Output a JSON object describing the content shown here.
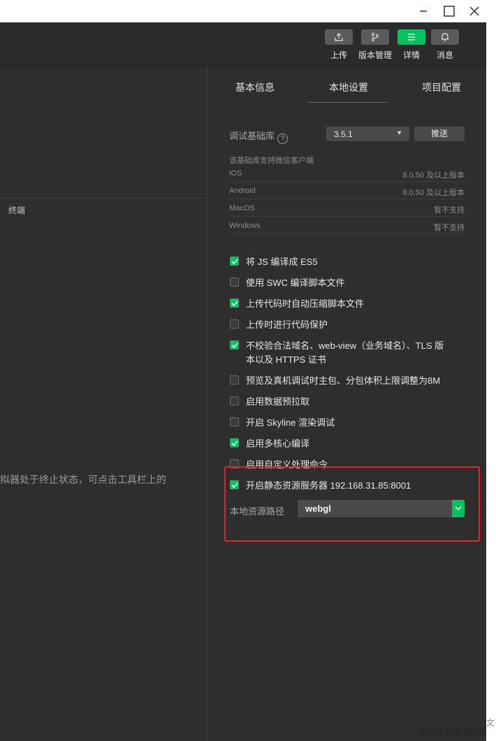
{
  "window_controls": {
    "minimize_icon": "minimize-icon",
    "maximize_icon": "maximize-icon",
    "close_icon": "close-icon"
  },
  "toolbar": {
    "buttons": [
      {
        "label": "上传",
        "icon": "upload-icon"
      },
      {
        "label": "版本管理",
        "icon": "branch-icon"
      },
      {
        "label": "详情",
        "icon": "menu-icon",
        "active": true
      },
      {
        "label": "消息",
        "icon": "bell-icon"
      }
    ]
  },
  "left_pane": {
    "terminal_tab": "终端",
    "simulator_message": "拟器处于终止状态，可点击工具栏上的"
  },
  "tabs": [
    "基本信息",
    "本地设置",
    "项目配置"
  ],
  "active_tab": "本地设置",
  "debug_lib": {
    "label": "调试基础库",
    "help": "?",
    "version": "3.5.1",
    "push_label": "推送",
    "compat_title": "该基础库支持微信客户端",
    "compat": [
      {
        "os": "iOS",
        "status": "8.0.50 及以上版本"
      },
      {
        "os": "Android",
        "status": "8.0.50 及以上版本"
      },
      {
        "os": "MacOS",
        "status": "暂不支持"
      },
      {
        "os": "Windows",
        "status": "暂不支持"
      }
    ]
  },
  "options": [
    {
      "label": "将 JS 编译成 ES5",
      "checked": true
    },
    {
      "label": "使用 SWC 编译脚本文件",
      "checked": false
    },
    {
      "label": "上传代码时自动压缩脚本文件",
      "checked": true
    },
    {
      "label": "上传时进行代码保护",
      "checked": false
    },
    {
      "label": "不校验合法域名、web-view（业务域名）、TLS 版本以及 HTTPS 证书",
      "checked": true
    },
    {
      "label": "预览及真机调试时主包、分包体积上限调整为8M",
      "checked": false
    },
    {
      "label": "启用数据预拉取",
      "checked": false
    },
    {
      "label": "开启 Skyline 渲染调试",
      "checked": false
    },
    {
      "label": "启用多核心编译",
      "checked": true
    },
    {
      "label": "启用自定义处理命令",
      "checked": false
    },
    {
      "label": "开启静态资源服务器 192.168.31.85:8001",
      "checked": true
    }
  ],
  "local_resource": {
    "label": "本地资源路径",
    "value": "webgl"
  },
  "colors": {
    "accent": "#07c160",
    "highlight_box": "#e8202a",
    "panel": "#2e2e2e"
  },
  "edge_text": "文盐",
  "watermark": "CSDN @清酒词话"
}
